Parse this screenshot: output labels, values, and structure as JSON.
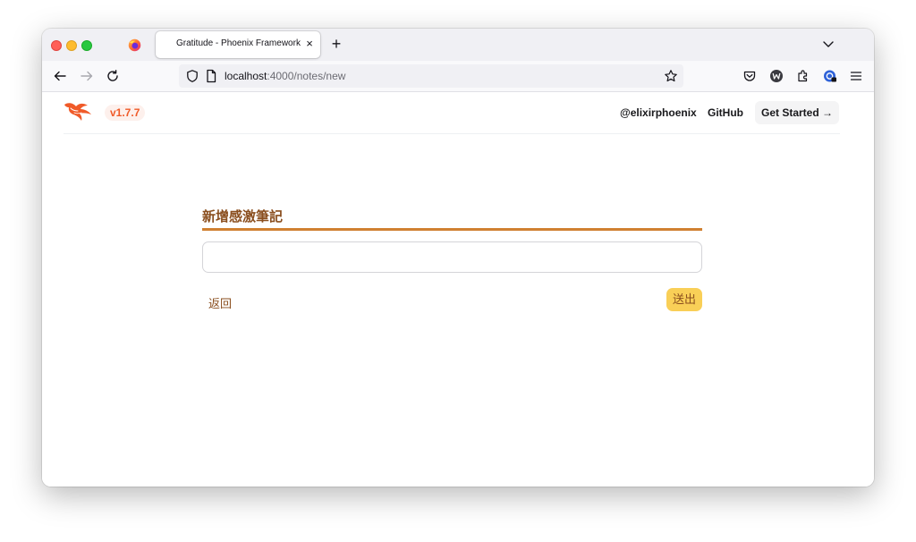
{
  "browser": {
    "tab_title": "Gratitude - Phoenix Framework",
    "tab_close_glyph": "×",
    "new_tab_glyph": "+",
    "url_host": "localhost",
    "url_rest": ":4000/notes/new",
    "icons": [
      "firefox-icon",
      "back-icon",
      "forward-icon",
      "reload-icon",
      "shield-icon",
      "page-icon",
      "bookmark-star-icon",
      "pocket-icon",
      "account-icon",
      "extensions-icon",
      "password-icon",
      "menu-icon",
      "list-tabs-icon"
    ]
  },
  "header": {
    "version": "v1.7.7",
    "links": [
      "@elixirphoenix",
      "GitHub"
    ],
    "cta": "Get Started →",
    "brand_color": "#f05a28"
  },
  "form": {
    "title": "新增感激筆記",
    "input_value": "",
    "back_label": "返回",
    "submit_label": "送出",
    "accent_color": "#d08031",
    "button_color": "#f9cf57"
  }
}
